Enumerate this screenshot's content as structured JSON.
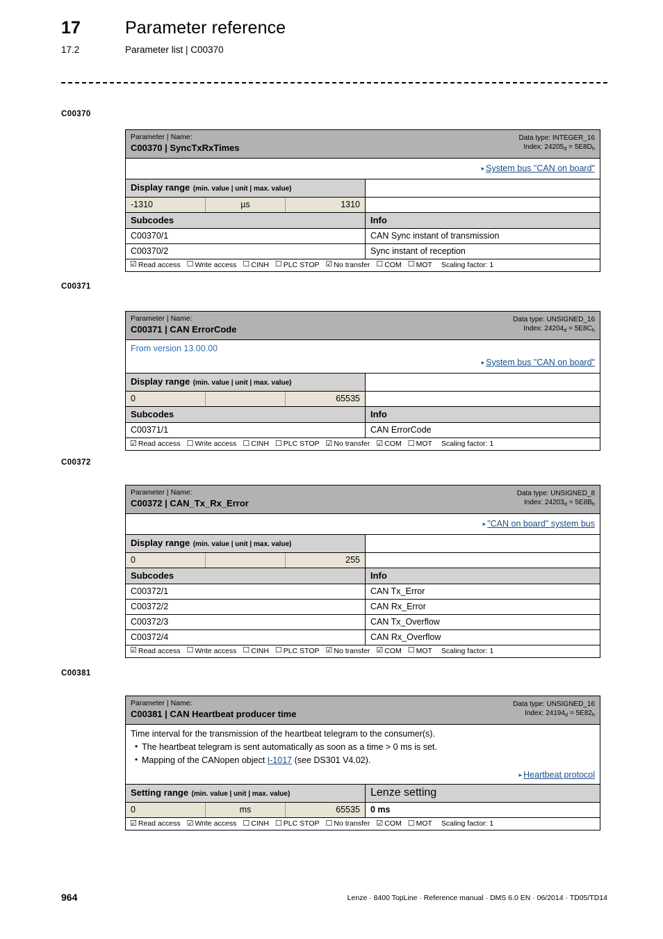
{
  "header": {
    "chapter_number": "17",
    "chapter_title": "Parameter reference",
    "section_number": "17.2",
    "section_title": "Parameter list | C00370"
  },
  "footer": {
    "page_number": "964",
    "credit": "Lenze · 8400 TopLine · Reference manual · DMS 6.0 EN · 06/2014 · TD05/TD14"
  },
  "labels": {
    "param_name_caption": "Parameter | Name:",
    "display_range_title": "Display range",
    "setting_range_title": "Setting range",
    "range_subtitle": "(min. value | unit | max. value)",
    "subcodes_title": "Subcodes",
    "info_title": "Info",
    "lenze_setting_title": "Lenze setting",
    "read_access": "Read access",
    "write_access": "Write access",
    "cinh": "CINH",
    "plc_stop": "PLC STOP",
    "no_transfer": "No transfer",
    "com": "COM",
    "mot": "MOT",
    "scaling_factor": "Scaling factor: 1",
    "checked_glyph": "☑",
    "unchecked_glyph": "☐",
    "triangle_glyph": "▸"
  },
  "colors": {
    "header_bar": "#b2b2b2",
    "table_header": "#d2d2d2",
    "range_value": "#e8e4d5",
    "link": "#1b4f8a",
    "version_text": "#2e6ead"
  },
  "blocks": [
    {
      "margin_code": "C00370",
      "code": "C00370",
      "name": "C00370 | SyncTxRxTimes",
      "data_type": "Data type: INTEGER_16",
      "index_label": "Index:",
      "index_dec": "24205",
      "index_hex": "5E8D",
      "from_version": null,
      "link_text": "System bus \"CAN on board\"",
      "description": null,
      "range_title": "Display range",
      "range_min": "-1310",
      "range_unit": "µs",
      "range_max": "1310",
      "right_header": "",
      "right_value": "",
      "subcodes": [
        {
          "code": "C00370/1",
          "info": "CAN Sync instant of transmission"
        },
        {
          "code": "C00370/2",
          "info": "Sync instant of reception"
        }
      ],
      "access": {
        "read": true,
        "write": false,
        "cinh": false,
        "plc_stop": false,
        "no_transfer": true,
        "com": false,
        "mot": false
      }
    },
    {
      "margin_code": "C00371",
      "code": "C00371",
      "name": "C00371 | CAN ErrorCode",
      "data_type": "Data type: UNSIGNED_16",
      "index_label": "Index:",
      "index_dec": "24204",
      "index_hex": "5E8C",
      "from_version": "From version 13.00.00",
      "link_text": "System bus \"CAN on board\"",
      "description": null,
      "range_title": "Display range",
      "range_min": "0",
      "range_unit": "",
      "range_max": "65535",
      "right_header": "",
      "right_value": "",
      "subcodes": [
        {
          "code": "C00371/1",
          "info": "CAN ErrorCode"
        }
      ],
      "access": {
        "read": true,
        "write": false,
        "cinh": false,
        "plc_stop": false,
        "no_transfer": true,
        "com": true,
        "mot": false
      }
    },
    {
      "margin_code": "C00372",
      "code": "C00372",
      "name": "C00372 | CAN_Tx_Rx_Error",
      "data_type": "Data type: UNSIGNED_8",
      "index_label": "Index:",
      "index_dec": "24203",
      "index_hex": "5E8B",
      "from_version": null,
      "link_text": "\"CAN on board\" system bus",
      "description": null,
      "range_title": "Display range",
      "range_min": "0",
      "range_unit": "",
      "range_max": "255",
      "right_header": "",
      "right_value": "",
      "subcodes": [
        {
          "code": "C00372/1",
          "info": "CAN Tx_Error"
        },
        {
          "code": "C00372/2",
          "info": "CAN Rx_Error"
        },
        {
          "code": "C00372/3",
          "info": "CAN Tx_Overflow"
        },
        {
          "code": "C00372/4",
          "info": "CAN Rx_Overflow"
        }
      ],
      "access": {
        "read": true,
        "write": false,
        "cinh": false,
        "plc_stop": false,
        "no_transfer": true,
        "com": true,
        "mot": false
      }
    },
    {
      "margin_code": "C00381",
      "code": "C00381",
      "name": "C00381 | CAN Heartbeat producer time",
      "data_type": "Data type: UNSIGNED_16",
      "index_label": "Index:",
      "index_dec": "24194",
      "index_hex": "5E82",
      "from_version": null,
      "link_text": "Heartbeat protocol",
      "description": {
        "intro": "Time interval for the transmission of the heartbeat telegram to the consumer(s).",
        "bullets": [
          {
            "before": "The heartbeat telegram is sent automatically as soon as a time > 0 ms is set.",
            "link": null,
            "after": ""
          },
          {
            "before": "Mapping of the CANopen object ",
            "link": "I-1017",
            "after": " (see DS301 V4.02)."
          }
        ]
      },
      "range_title": "Setting range",
      "range_min": "0",
      "range_unit": "ms",
      "range_max": "65535",
      "right_header": "Lenze setting",
      "right_value": "0 ms",
      "subcodes": [],
      "access": {
        "read": true,
        "write": true,
        "cinh": false,
        "plc_stop": false,
        "no_transfer": false,
        "com": true,
        "mot": false
      }
    }
  ]
}
